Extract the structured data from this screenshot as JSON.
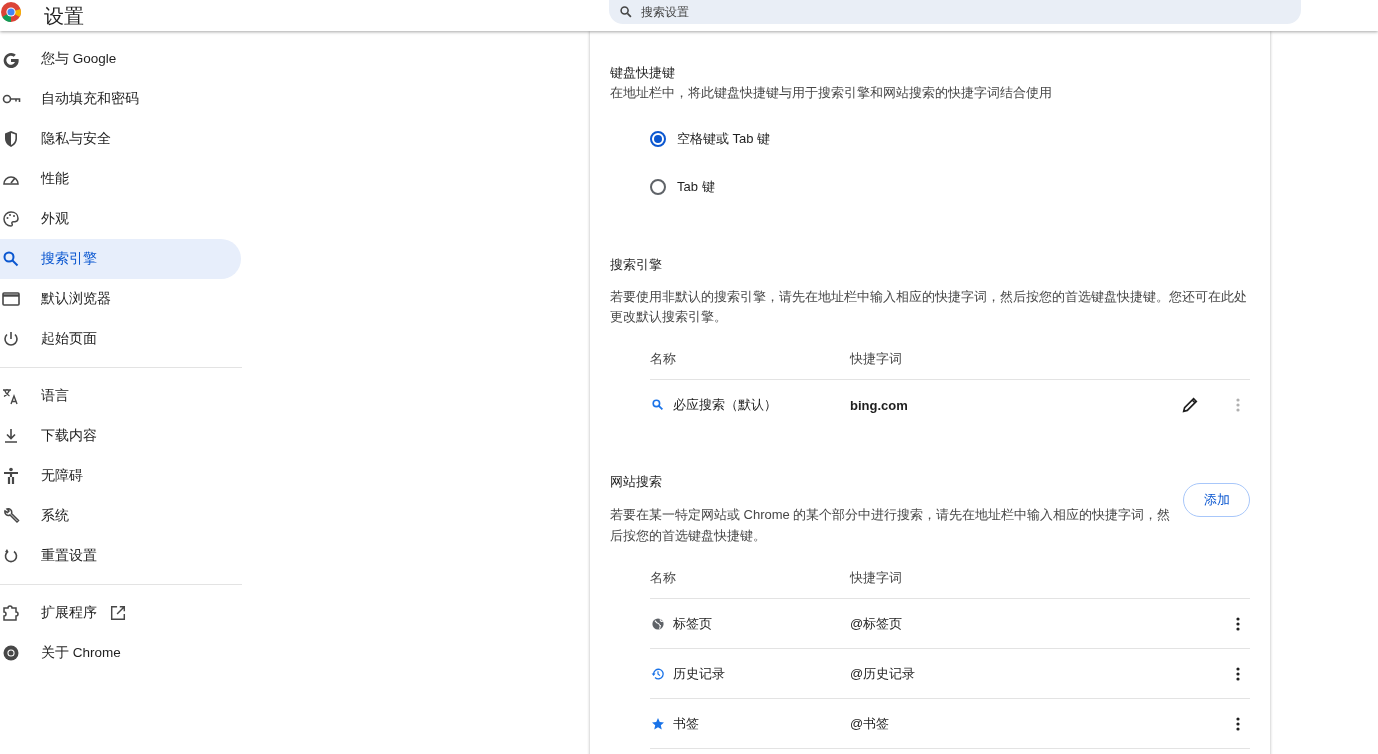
{
  "header": {
    "title": "设置",
    "search_placeholder": "搜索设置"
  },
  "sidebar": {
    "sections": [
      {
        "items": [
          {
            "label": "您与 Google",
            "selected": false
          },
          {
            "label": "自动填充和密码",
            "selected": false
          },
          {
            "label": "隐私与安全",
            "selected": false
          },
          {
            "label": "性能",
            "selected": false
          },
          {
            "label": "外观",
            "selected": false
          },
          {
            "label": "搜索引擎",
            "selected": true
          },
          {
            "label": "默认浏览器",
            "selected": false
          },
          {
            "label": "起始页面",
            "selected": false
          }
        ]
      },
      {
        "items": [
          {
            "label": "语言",
            "selected": false
          },
          {
            "label": "下载内容",
            "selected": false
          },
          {
            "label": "无障碍",
            "selected": false
          },
          {
            "label": "系统",
            "selected": false
          },
          {
            "label": "重置设置",
            "selected": false
          }
        ]
      },
      {
        "items": [
          {
            "label": "扩展程序",
            "selected": false,
            "external": true
          },
          {
            "label": "关于 Chrome",
            "selected": false,
            "external": false
          }
        ]
      }
    ]
  },
  "keyboard_shortcut": {
    "title": "键盘快捷键",
    "description": "在地址栏中，将此键盘快捷键与用于搜索引擎和网站搜索的快捷字词结合使用",
    "options": [
      {
        "label": "空格键或 Tab 键",
        "selected": true
      },
      {
        "label": "Tab 键",
        "selected": false
      }
    ]
  },
  "search_engines": {
    "title": "搜索引擎",
    "description": "若要使用非默认的搜索引擎，请先在地址栏中输入相应的快捷字词，然后按您的首选键盘快捷键。您还可在此处更改默认搜索引擎。",
    "columns": [
      "名称",
      "快捷字词"
    ],
    "rows": [
      {
        "name": "必应搜索（默认）",
        "keyword": "bing.com",
        "editable": true,
        "menu_disabled": true
      }
    ]
  },
  "site_search": {
    "title": "网站搜索",
    "description": "若要在某一特定网站或 Chrome 的某个部分中进行搜索，请先在地址栏中输入相应的快捷字词，然后按您的首选键盘快捷键。",
    "add_button": "添加",
    "columns": [
      "名称",
      "快捷字词"
    ],
    "rows": [
      {
        "name": "标签页",
        "keyword": "@标签页",
        "editable": false,
        "menu_disabled": false
      },
      {
        "name": "历史记录",
        "keyword": "@历史记录",
        "editable": false,
        "menu_disabled": false
      },
      {
        "name": "书签",
        "keyword": "@书签",
        "editable": false,
        "menu_disabled": false
      }
    ]
  }
}
